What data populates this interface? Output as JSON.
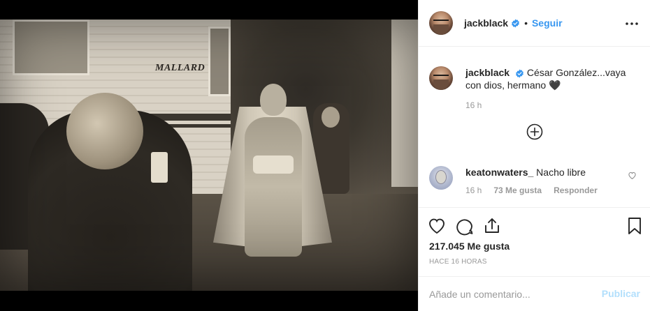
{
  "post": {
    "author": {
      "username": "jackblack",
      "verified": true,
      "follow_label": "Seguir",
      "separator": "•"
    },
    "more_icon": "more-horizontal-icon",
    "photo": {
      "brand_text": "MALLARD"
    },
    "caption": {
      "username": "jackblack",
      "text": "César González...vaya con dios, hermano 🖤",
      "time": "16 h"
    },
    "load_more_icon": "plus-circle-icon",
    "comments": [
      {
        "username": "keatonwaters_",
        "text": "Nacho libre",
        "time": "16 h",
        "likes": "73 Me gusta",
        "reply_label": "Responder"
      }
    ],
    "actions": {
      "like_icon": "heart-icon",
      "comment_icon": "comment-icon",
      "share_icon": "share-icon",
      "save_icon": "bookmark-icon"
    },
    "likes_count": "217.045 Me gusta",
    "posted_ago": "HACE 16 HORAS",
    "add_comment": {
      "placeholder": "Añade un comentario...",
      "publish_label": "Publicar"
    }
  },
  "colors": {
    "link_blue": "#3897f0",
    "publish_disabled": "#b2dffc",
    "muted_text": "#999999",
    "border": "#efefef"
  }
}
